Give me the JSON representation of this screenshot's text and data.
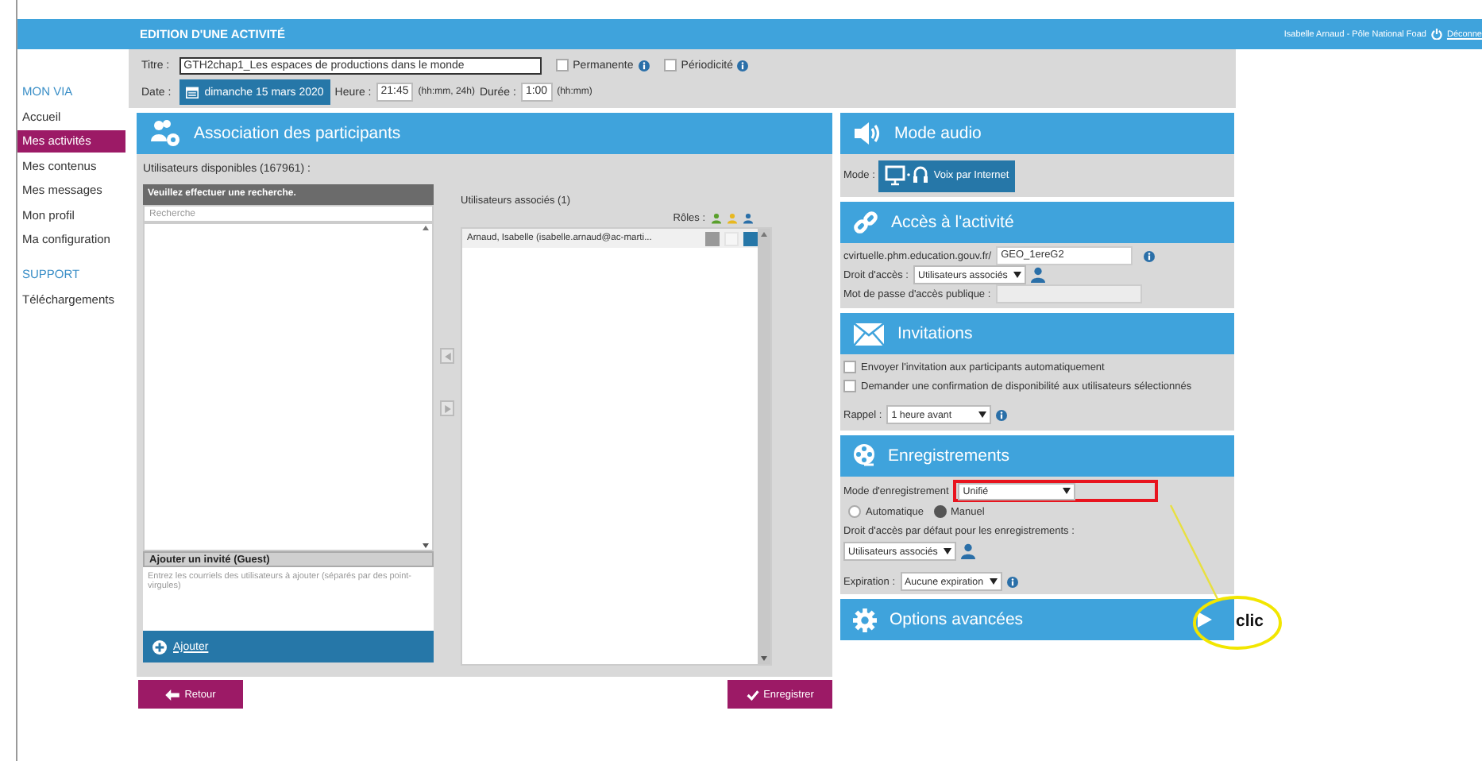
{
  "header": {
    "title": "EDITION D'UNE ACTIVITÉ",
    "user": "Isabelle Arnaud - Pôle National Foad",
    "logout": "Déconne"
  },
  "sidebar": [
    {
      "heading": "MON VIA",
      "items": [
        {
          "label": "Accueil",
          "selected": false
        },
        {
          "label": "Mes activités",
          "selected": true
        },
        {
          "label": "Mes contenus",
          "selected": false
        },
        {
          "label": "Mes messages",
          "selected": false
        },
        {
          "label": "Mon profil",
          "selected": false
        },
        {
          "label": "Ma configuration",
          "selected": false
        }
      ]
    },
    {
      "heading": "SUPPORT",
      "items": [
        {
          "label": "Téléchargements",
          "selected": false
        }
      ]
    }
  ],
  "activity": {
    "title_label": "Titre :",
    "title": "GTH2chap1_Les espaces de productions dans le monde",
    "flags": [
      {
        "label": "Permanente",
        "checked": false
      },
      {
        "label": "Périodicité",
        "checked": false
      }
    ],
    "date_label": "Date :",
    "date": "dimanche 15 mars 2020",
    "time_label": "Heure :",
    "time": "21:45",
    "time_hint": "(hh:mm, 24h)",
    "duration_label": "Durée :",
    "duration": "1:00",
    "duration_hint": "(hh:mm)"
  },
  "participants": {
    "title": "Association des participants",
    "available_label": "Utilisateurs disponibles (167961) :",
    "available_header": "Veuillez effectuer une recherche.",
    "search_placeholder": "Recherche",
    "guest_title": "Ajouter un invité (Guest)",
    "guest_placeholder": "Entrez les courriels des utilisateurs à ajouter (séparés par des point-virgules)",
    "add_button": "Ajouter",
    "associated_label": "Utilisateurs associés (1)",
    "roles_label": "Rôles :",
    "role_icons": [
      {
        "color": "#5aa02c"
      },
      {
        "color": "#e8b820"
      },
      {
        "color": "#2a6fa8"
      }
    ],
    "associated": [
      {
        "name": "Arnaud, Isabelle (isabelle.arnaud@ac-marti...",
        "roles": [
          {
            "disabled": false,
            "selected": false
          },
          {
            "disabled": true,
            "selected": false
          },
          {
            "disabled": false,
            "selected": true
          }
        ]
      }
    ]
  },
  "sections": [
    {
      "kind": "audio",
      "title": "Mode audio",
      "mode_label": "Mode :",
      "mode": "Voix par Internet"
    },
    {
      "kind": "access",
      "title": "Accès à l'activité",
      "url_prefix": "cvirtuelle.phm.education.gouv.fr/",
      "room": "GEO_1ereG2",
      "right_label": "Droit d'accès :",
      "right": "Utilisateurs associés",
      "password_label": "Mot de passe d'accès publique :"
    },
    {
      "kind": "invitations",
      "title": "Invitations",
      "options": [
        {
          "label": "Envoyer l'invitation aux participants automatiquement",
          "checked": false
        },
        {
          "label": "Demander une confirmation de disponibilité aux utilisateurs sélectionnés",
          "checked": false
        }
      ],
      "reminder_label": "Rappel :",
      "reminder": "1 heure avant"
    },
    {
      "kind": "recordings",
      "title": "Enregistrements",
      "mode_label": "Mode d'enregistrement",
      "mode": "Unifié",
      "highlighted": true,
      "triggers": [
        {
          "label": "Automatique",
          "selected": false
        },
        {
          "label": "Manuel",
          "selected": true
        }
      ],
      "rights_label": "Droit d'accès par défaut pour les enregistrements :",
      "rights": "Utilisateurs associés",
      "expiry_label": "Expiration :",
      "expiry": "Aucune expiration"
    },
    {
      "kind": "advanced",
      "title": "Options avancées",
      "expanded": false
    }
  ],
  "buttons": {
    "back": "Retour",
    "save": "Enregistrer"
  },
  "annotation": {
    "label": "clic"
  }
}
